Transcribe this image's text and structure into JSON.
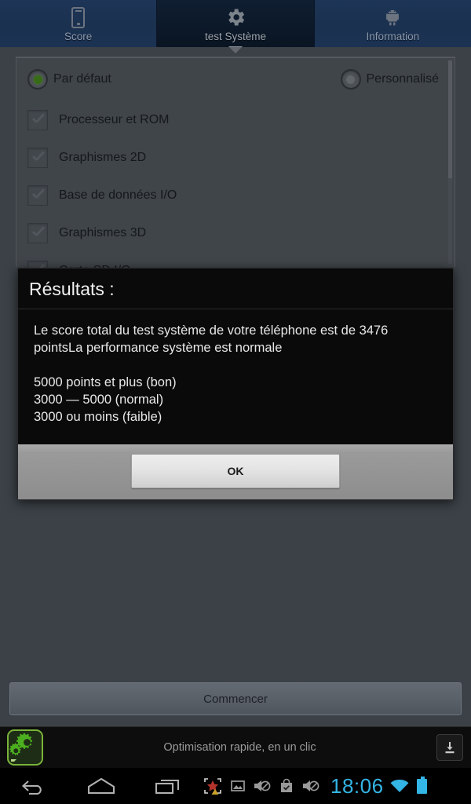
{
  "tabs": [
    {
      "label": "Score",
      "icon": "phone-icon",
      "active": false
    },
    {
      "label": "test Système",
      "icon": "gear-icon",
      "active": true
    },
    {
      "label": "Information",
      "icon": "android-icon",
      "active": false
    }
  ],
  "panel": {
    "modes": [
      {
        "label": "Par défaut",
        "selected": true
      },
      {
        "label": "Personnalisé",
        "selected": false
      }
    ],
    "tests": [
      {
        "label": "Processeur et ROM",
        "checked": true
      },
      {
        "label": "Graphismes 2D",
        "checked": true
      },
      {
        "label": "Base de données I/O",
        "checked": true
      },
      {
        "label": "Graphismes 3D",
        "checked": true
      },
      {
        "label": "Carte SD I/O",
        "checked": true
      }
    ]
  },
  "dialog": {
    "title": "Résultats :",
    "paragraph1": "Le score total du test système de votre téléphone est de 3476 pointsLa performance système est normale",
    "scale_line1": "5000 points et plus (bon)",
    "scale_line2": "3000 — 5000 (normal)",
    "scale_line3": "3000 ou moins (faible)",
    "ok_label": "OK"
  },
  "start_button": {
    "label": "Commencer"
  },
  "ad": {
    "text": "Optimisation rapide, en un clic",
    "icon": "gears-icon",
    "download_icon": "download-icon"
  },
  "navbar": {
    "back": "back-icon",
    "home": "home-icon",
    "recents": "recents-icon"
  },
  "statusbar": {
    "icons": [
      "screenshot-icon",
      "image-icon",
      "mute-icon",
      "play-store-icon",
      "mute-icon"
    ],
    "time": "18:06",
    "wifi": "wifi-icon",
    "battery": "battery-icon"
  },
  "colors": {
    "accent_blue": "#33b5e5",
    "tab_active_bg": "#0c1829",
    "tab_bg": "#1d3557",
    "page_bg": "#555d66",
    "radio_green": "#4f9a22",
    "ad_green": "#79b33a"
  }
}
